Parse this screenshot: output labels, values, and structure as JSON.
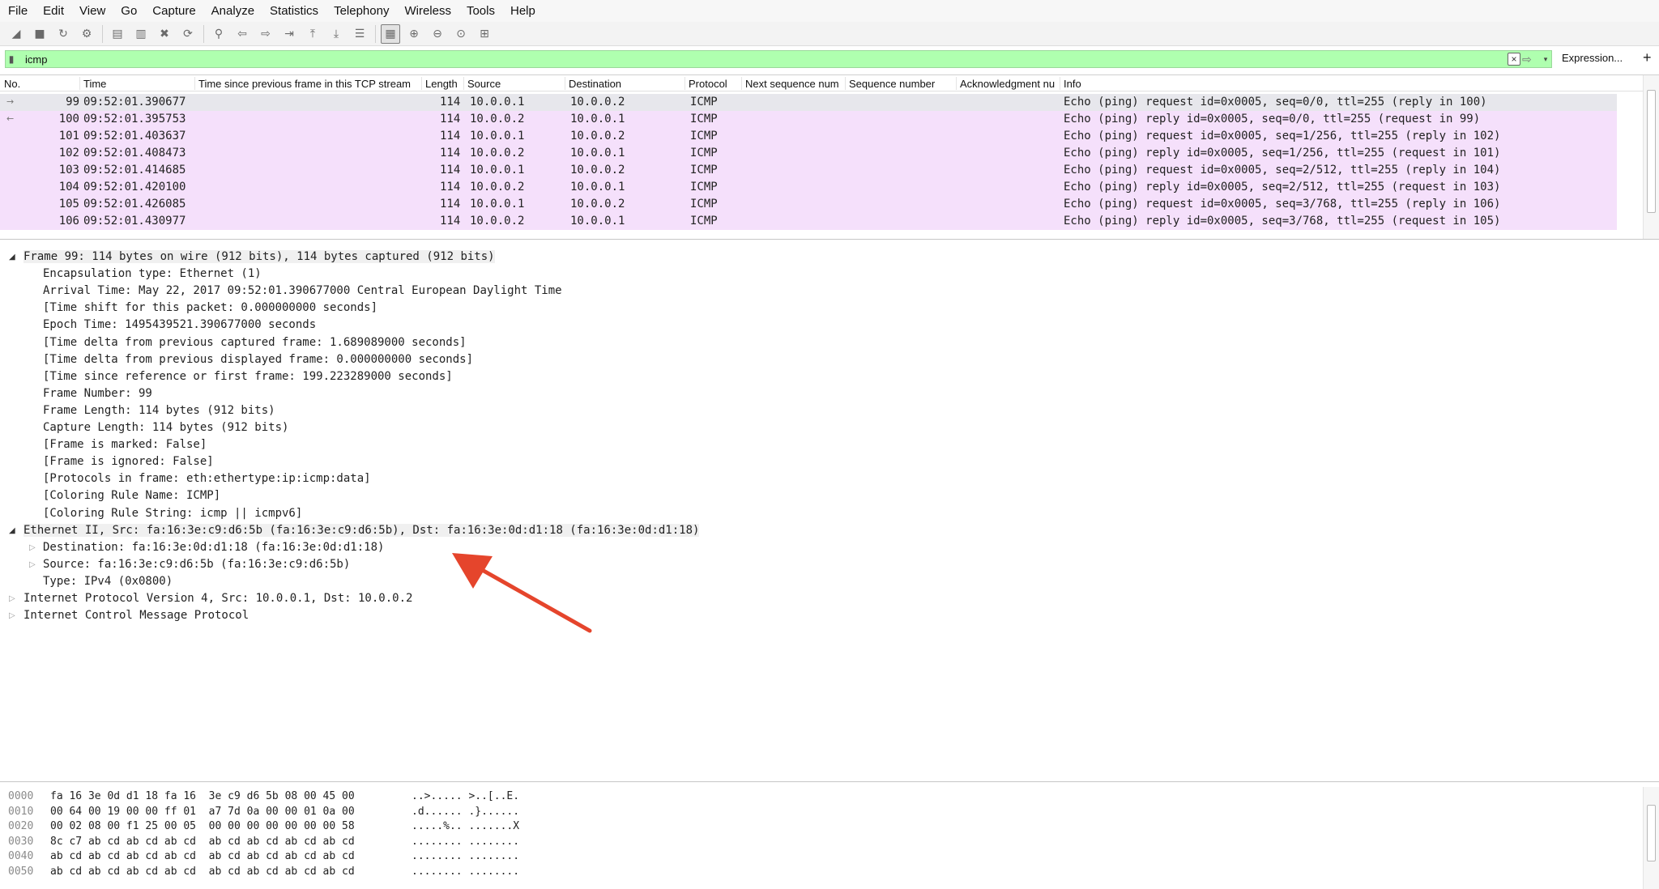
{
  "menu": [
    "File",
    "Edit",
    "View",
    "Go",
    "Capture",
    "Analyze",
    "Statistics",
    "Telephony",
    "Wireless",
    "Tools",
    "Help"
  ],
  "toolbar": {
    "icons": [
      "start-capture-icon",
      "stop-capture-icon",
      "restart-capture-icon",
      "capture-options-icon",
      "open-file-icon",
      "save-file-icon",
      "close-file-icon",
      "reload-file-icon",
      "find-packet-icon",
      "go-back-icon",
      "go-forward-icon",
      "go-to-packet-icon",
      "go-first-icon",
      "go-last-icon",
      "autoscroll-icon",
      "colorize-icon",
      "zoom-in-icon",
      "zoom-out-icon",
      "zoom-normal-icon",
      "resize-columns-icon"
    ]
  },
  "filter": {
    "value": "icmp",
    "expression_label": "Expression...",
    "add_label": "+",
    "clear_label": "×",
    "apply_label": "⇨",
    "dropdown_label": "▾",
    "bg_color": "#afffaf"
  },
  "packet_list": {
    "columns": [
      "No.",
      "Time",
      "Time since previous frame in this TCP stream",
      "Length",
      "Source",
      "Destination",
      "Protocol",
      "Next sequence num",
      "Sequence number",
      "Acknowledgment nu",
      "Info"
    ],
    "row_color": "#f5e0fb",
    "rows": [
      {
        "marker": "→",
        "no": "99",
        "time": "09:52:01.390677",
        "length": "114",
        "source": "10.0.0.1",
        "destination": "10.0.0.2",
        "protocol": "ICMP",
        "info": "Echo (ping) request  id=0x0005, seq=0/0, ttl=255 (reply in 100)"
      },
      {
        "marker": "←",
        "no": "100",
        "time": "09:52:01.395753",
        "length": "114",
        "source": "10.0.0.2",
        "destination": "10.0.0.1",
        "protocol": "ICMP",
        "info": "Echo (ping) reply    id=0x0005, seq=0/0, ttl=255 (request in 99)"
      },
      {
        "marker": "",
        "no": "101",
        "time": "09:52:01.403637",
        "length": "114",
        "source": "10.0.0.1",
        "destination": "10.0.0.2",
        "protocol": "ICMP",
        "info": "Echo (ping) request  id=0x0005, seq=1/256, ttl=255 (reply in 102)"
      },
      {
        "marker": "",
        "no": "102",
        "time": "09:52:01.408473",
        "length": "114",
        "source": "10.0.0.2",
        "destination": "10.0.0.1",
        "protocol": "ICMP",
        "info": "Echo (ping) reply    id=0x0005, seq=1/256, ttl=255 (request in 101)"
      },
      {
        "marker": "",
        "no": "103",
        "time": "09:52:01.414685",
        "length": "114",
        "source": "10.0.0.1",
        "destination": "10.0.0.2",
        "protocol": "ICMP",
        "info": "Echo (ping) request  id=0x0005, seq=2/512, ttl=255 (reply in 104)"
      },
      {
        "marker": "",
        "no": "104",
        "time": "09:52:01.420100",
        "length": "114",
        "source": "10.0.0.2",
        "destination": "10.0.0.1",
        "protocol": "ICMP",
        "info": "Echo (ping) reply    id=0x0005, seq=2/512, ttl=255 (request in 103)"
      },
      {
        "marker": "",
        "no": "105",
        "time": "09:52:01.426085",
        "length": "114",
        "source": "10.0.0.1",
        "destination": "10.0.0.2",
        "protocol": "ICMP",
        "info": "Echo (ping) request  id=0x0005, seq=3/768, ttl=255 (reply in 106)"
      },
      {
        "marker": "",
        "no": "106",
        "time": "09:52:01.430977",
        "length": "114",
        "source": "10.0.0.2",
        "destination": "10.0.0.1",
        "protocol": "ICMP",
        "info": "Echo (ping) reply    id=0x0005, seq=3/768, ttl=255 (request in 105)"
      }
    ]
  },
  "details": [
    {
      "text": "Frame 99: 114 bytes on wire (912 bits), 114 bytes captured (912 bits)",
      "level": 0,
      "toggle": "open",
      "highlight": true
    },
    {
      "text": "Encapsulation type: Ethernet (1)",
      "level": 1,
      "toggle": ""
    },
    {
      "text": "Arrival Time: May 22, 2017 09:52:01.390677000 Central European Daylight Time",
      "level": 1,
      "toggle": ""
    },
    {
      "text": "[Time shift for this packet: 0.000000000 seconds]",
      "level": 1,
      "toggle": ""
    },
    {
      "text": "Epoch Time: 1495439521.390677000 seconds",
      "level": 1,
      "toggle": ""
    },
    {
      "text": "[Time delta from previous captured frame: 1.689089000 seconds]",
      "level": 1,
      "toggle": ""
    },
    {
      "text": "[Time delta from previous displayed frame: 0.000000000 seconds]",
      "level": 1,
      "toggle": ""
    },
    {
      "text": "[Time since reference or first frame: 199.223289000 seconds]",
      "level": 1,
      "toggle": ""
    },
    {
      "text": "Frame Number: 99",
      "level": 1,
      "toggle": ""
    },
    {
      "text": "Frame Length: 114 bytes (912 bits)",
      "level": 1,
      "toggle": ""
    },
    {
      "text": "Capture Length: 114 bytes (912 bits)",
      "level": 1,
      "toggle": ""
    },
    {
      "text": "[Frame is marked: False]",
      "level": 1,
      "toggle": ""
    },
    {
      "text": "[Frame is ignored: False]",
      "level": 1,
      "toggle": ""
    },
    {
      "text": "[Protocols in frame: eth:ethertype:ip:icmp:data]",
      "level": 1,
      "toggle": ""
    },
    {
      "text": "[Coloring Rule Name: ICMP]",
      "level": 1,
      "toggle": ""
    },
    {
      "text": "[Coloring Rule String: icmp || icmpv6]",
      "level": 1,
      "toggle": ""
    },
    {
      "text": "Ethernet II, Src: fa:16:3e:c9:d6:5b (fa:16:3e:c9:d6:5b), Dst: fa:16:3e:0d:d1:18 (fa:16:3e:0d:d1:18)",
      "level": 0,
      "toggle": "open",
      "highlight": true
    },
    {
      "text": "Destination: fa:16:3e:0d:d1:18 (fa:16:3e:0d:d1:18)",
      "level": 1,
      "toggle": "closed"
    },
    {
      "text": "Source: fa:16:3e:c9:d6:5b (fa:16:3e:c9:d6:5b)",
      "level": 1,
      "toggle": "closed"
    },
    {
      "text": "Type: IPv4 (0x0800)",
      "level": 1,
      "toggle": ""
    },
    {
      "text": "Internet Protocol Version 4, Src: 10.0.0.1, Dst: 10.0.0.2",
      "level": 0,
      "toggle": "closed"
    },
    {
      "text": "Internet Control Message Protocol",
      "level": 0,
      "toggle": "closed"
    }
  ],
  "hex": [
    {
      "offset": "0000",
      "bytes": "fa 16 3e 0d d1 18 fa 16  3e c9 d6 5b 08 00 45 00",
      "ascii": "..>..... >..[..E."
    },
    {
      "offset": "0010",
      "bytes": "00 64 00 19 00 00 ff 01  a7 7d 0a 00 00 01 0a 00",
      "ascii": ".d...... .}......"
    },
    {
      "offset": "0020",
      "bytes": "00 02 08 00 f1 25 00 05  00 00 00 00 00 00 00 58",
      "ascii": ".....%.. .......X"
    },
    {
      "offset": "0030",
      "bytes": "8c c7 ab cd ab cd ab cd  ab cd ab cd ab cd ab cd",
      "ascii": "........ ........"
    },
    {
      "offset": "0040",
      "bytes": "ab cd ab cd ab cd ab cd  ab cd ab cd ab cd ab cd",
      "ascii": "........ ........"
    },
    {
      "offset": "0050",
      "bytes": "ab cd ab cd ab cd ab cd  ab cd ab cd ab cd ab cd",
      "ascii": "........ ........"
    }
  ],
  "annotation": {
    "arrow_color": "#e5452c"
  }
}
